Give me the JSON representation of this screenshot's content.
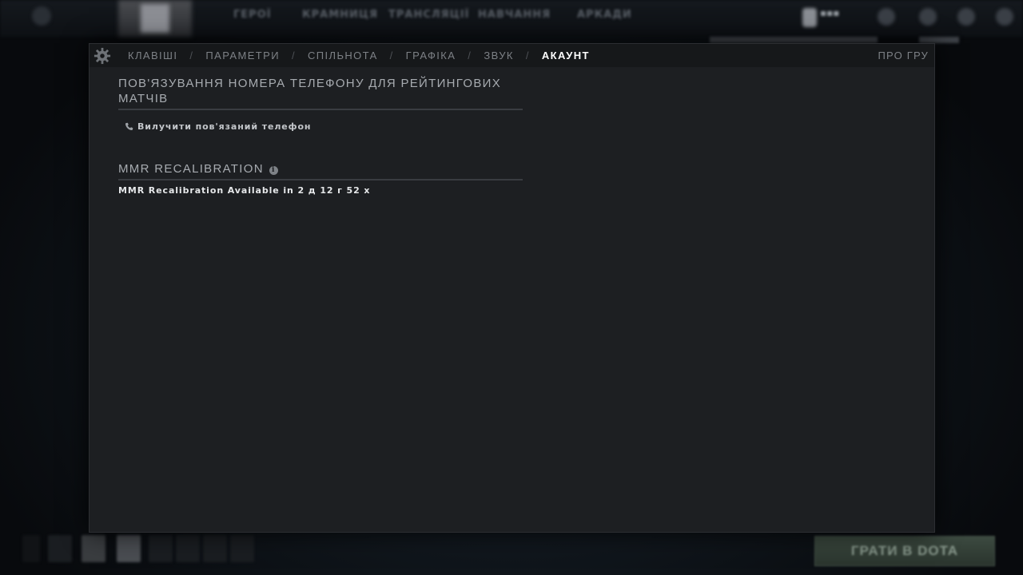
{
  "settings": {
    "tabs": [
      {
        "label": "КЛАВІШІ",
        "active": false
      },
      {
        "label": "ПАРАМЕТРИ",
        "active": false
      },
      {
        "label": "СПІЛЬНОТА",
        "active": false
      },
      {
        "label": "ГРАФІКА",
        "active": false
      },
      {
        "label": "ЗВУК",
        "active": false
      },
      {
        "label": "АКАУНТ",
        "active": true
      }
    ],
    "separator": "/",
    "about_tab": "ПРО ГРУ",
    "gear_icon": "gear-icon"
  },
  "account": {
    "phone_section_title": "ПОВ'ЯЗУВАННЯ НОМЕРА ТЕЛЕФОНУ ДЛЯ РЕЙТИНГОВИХ МАТЧІВ",
    "remove_phone_label": "Вилучити пов'язаний телефон",
    "phone_icon": "phone-icon",
    "mmr_section_title": "MMR RECALIBRATION",
    "mmr_info_icon": "info-icon",
    "mmr_status": "MMR Recalibration Available in 2 д 12 г 52 х"
  },
  "background": {
    "top_nav": [
      "ГЕРОЇ",
      "КРАМНИЦЯ",
      "ТРАНСЛЯЦІЇ",
      "НАВЧАННЯ",
      "АРКАДИ"
    ],
    "play_button": "ГРАТИ В DOTA"
  }
}
